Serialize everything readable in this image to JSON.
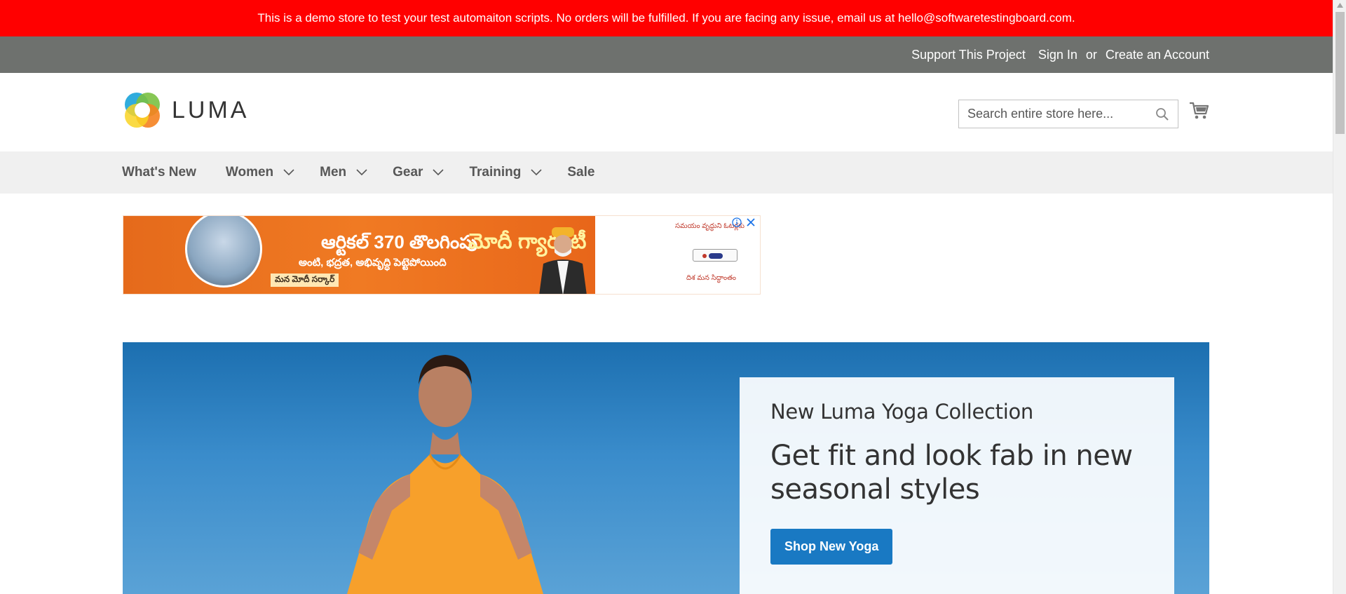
{
  "demo_notice": {
    "text": "This is a demo store to test your test automaiton scripts. No orders will be fulfilled. If you are facing any issue, email us at hello@softwaretestingboard.com."
  },
  "util_bar": {
    "support": "Support This Project",
    "sign_in": "Sign In",
    "or": "or",
    "create_account": "Create an Account"
  },
  "header": {
    "logo_text": "LUMA",
    "search_placeholder": "Search entire store here...",
    "search_value": ""
  },
  "nav": {
    "items": [
      {
        "label": "What's New",
        "has_submenu": false
      },
      {
        "label": "Women",
        "has_submenu": true
      },
      {
        "label": "Men",
        "has_submenu": true
      },
      {
        "label": "Gear",
        "has_submenu": true
      },
      {
        "label": "Training",
        "has_submenu": true
      },
      {
        "label": "Sale",
        "has_submenu": false
      }
    ]
  },
  "ad": {
    "headline": "ఆర్టికల్ 370 తొలగింపు",
    "line2": "అంటి, భద్రత, అభివృద్ధి పెట్టెపోయింది",
    "line3": "మన మోదీ సర్కార్",
    "slogan": "మోదీ గ్యారంటీ",
    "right_label": "సమయం వృద్ధుని ఓటర్లకు",
    "right_sub": "దిశ మన సిద్ధాంతం"
  },
  "hero": {
    "subtitle": "New Luma Yoga Collection",
    "title": "Get fit and look fab in new seasonal styles",
    "button": "Shop New Yoga"
  },
  "colors": {
    "demo_bar": "#ff0000",
    "util_bar": "#6e716e",
    "nav_bg": "#f0f0f0",
    "primary_button": "#1979c3",
    "hero_bg": "#2e7fbf"
  }
}
